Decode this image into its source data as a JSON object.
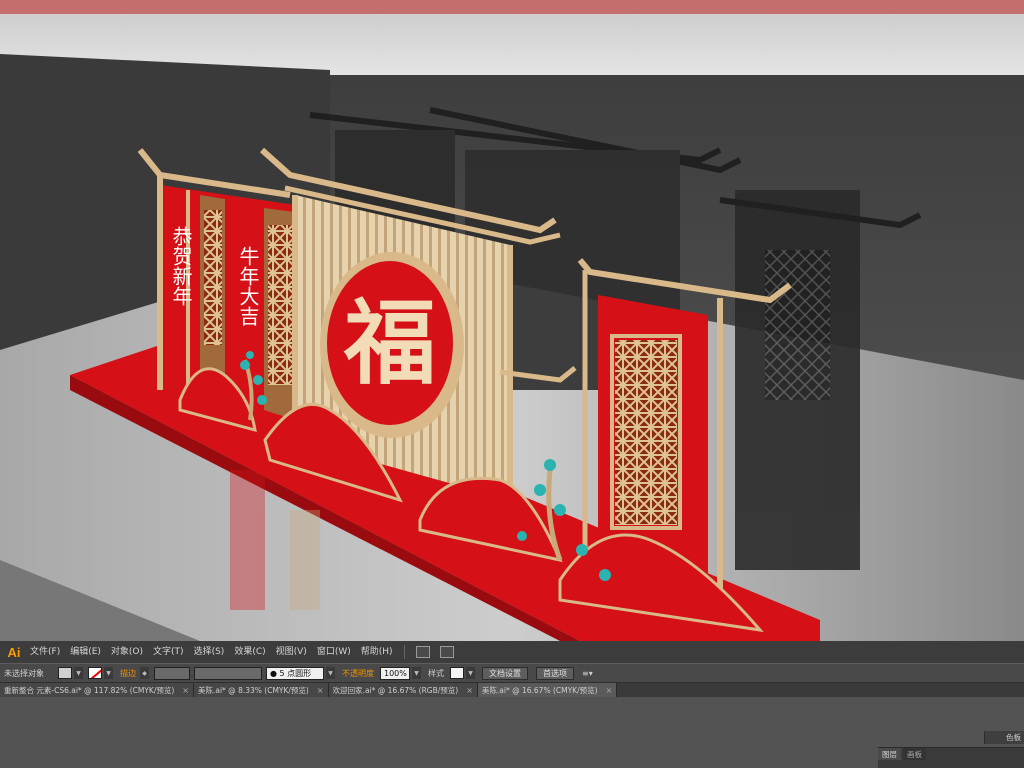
{
  "scene": {
    "banner_left": "恭贺新年",
    "banner_right": "牛年大吉",
    "emblem_char": "福",
    "colors": {
      "red": "#d51016",
      "gold": "#d9b98a",
      "wall": "#4a4a4a",
      "floor": "#c9c9c9"
    }
  },
  "app": {
    "logo": "Ai",
    "menu": [
      "文件(F)",
      "编辑(E)",
      "对象(O)",
      "文字(T)",
      "选择(S)",
      "效果(C)",
      "视图(V)",
      "窗口(W)",
      "帮助(H)"
    ],
    "icons": [
      "bridge-icon",
      "workspace-switcher-icon"
    ]
  },
  "control_bar": {
    "selection_status": "未选择对象",
    "stroke_label": "描边",
    "brush_value": "5 点圆形",
    "opacity_label": "不透明度",
    "opacity_value": "100%",
    "style_label": "样式",
    "doc_setup_button": "文档设置",
    "preferences_button": "首选项"
  },
  "tabs": [
    {
      "label": "重新整合 元素-CS6.ai* @ 117.82% (CMYK/预览)",
      "active": false
    },
    {
      "label": "美陈.ai* @ 8.33% (CMYK/预览)",
      "active": false
    },
    {
      "label": "欢迎回家.ai* @ 16.67% (RGB/预览)",
      "active": false
    },
    {
      "label": "美陈.ai* @ 16.67% (CMYK/预览)",
      "active": true
    }
  ],
  "panels": {
    "color": "色板",
    "bottom_tabs": [
      "图层",
      "画板"
    ]
  }
}
